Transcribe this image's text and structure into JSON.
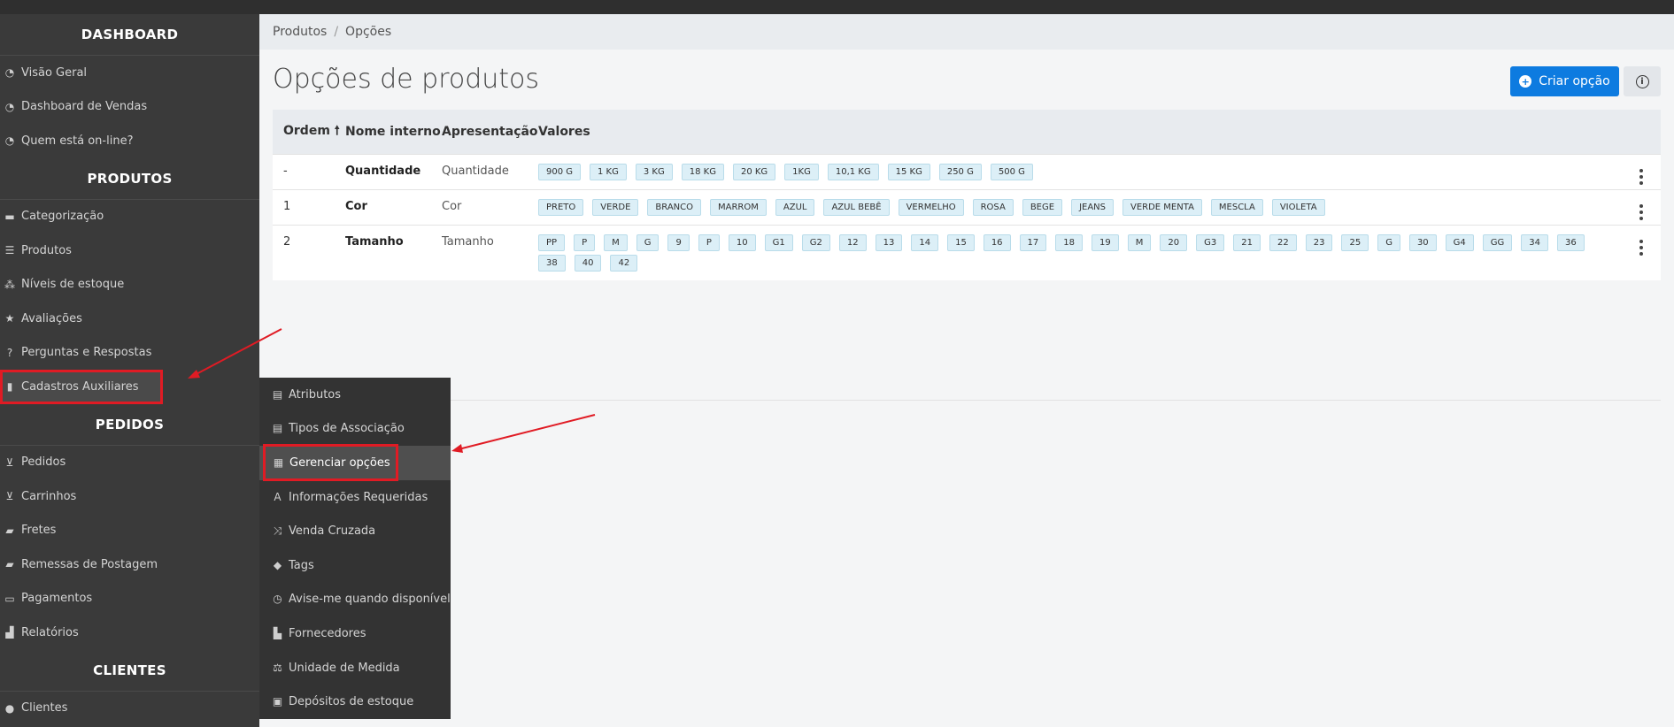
{
  "breadcrumb": [
    "Produtos",
    "Opções"
  ],
  "breadcrumb_sep": "/",
  "page_title": "Opções de produtos",
  "create_button": "Criar opção",
  "info_icon_glyph": "i",
  "sidebar": {
    "sections": [
      {
        "title": "DASHBOARD",
        "items": [
          {
            "label": "Visão Geral",
            "icon": "gauge-icon"
          },
          {
            "label": "Dashboard de Vendas",
            "icon": "gauge-icon"
          },
          {
            "label": "Quem está on-line?",
            "icon": "gauge-icon"
          }
        ]
      },
      {
        "title": "PRODUTOS",
        "items": [
          {
            "label": "Categorização",
            "icon": "folder-icon"
          },
          {
            "label": "Produtos",
            "icon": "list-icon"
          },
          {
            "label": "Níveis de estoque",
            "icon": "cubes-icon"
          },
          {
            "label": "Avaliações",
            "icon": "star-icon"
          },
          {
            "label": "Perguntas e Respostas",
            "icon": "question-icon"
          },
          {
            "label": "Cadastros Auxiliares",
            "icon": "file-icon"
          }
        ]
      },
      {
        "title": "PEDIDOS",
        "items": [
          {
            "label": "Pedidos",
            "icon": "cart-icon"
          },
          {
            "label": "Carrinhos",
            "icon": "cart-icon"
          },
          {
            "label": "Fretes",
            "icon": "truck-icon"
          },
          {
            "label": "Remessas de Postagem",
            "icon": "truck-icon"
          },
          {
            "label": "Pagamentos",
            "icon": "credit-card-icon"
          },
          {
            "label": "Relatórios",
            "icon": "bar-chart-icon"
          }
        ]
      },
      {
        "title": "CLIENTES",
        "items": [
          {
            "label": "Clientes",
            "icon": "user-icon"
          }
        ]
      }
    ]
  },
  "submenu": [
    {
      "label": "Atributos",
      "icon": "list-alt-icon"
    },
    {
      "label": "Tipos de Associação",
      "icon": "list-alt-icon"
    },
    {
      "label": "Gerenciar opções",
      "icon": "grid-icon"
    },
    {
      "label": "Informações Requeridas",
      "icon": "font-icon"
    },
    {
      "label": "Venda Cruzada",
      "icon": "random-icon"
    },
    {
      "label": "Tags",
      "icon": "tag-icon"
    },
    {
      "label": "Avise-me quando disponível",
      "icon": "clock-icon"
    },
    {
      "label": "Fornecedores",
      "icon": "industry-icon"
    },
    {
      "label": "Unidade de Medida",
      "icon": "balance-icon"
    },
    {
      "label": "Depósitos de estoque",
      "icon": "archive-icon"
    }
  ],
  "table": {
    "headers": [
      "Ordem",
      "Nome interno",
      "Apresentação",
      "Valores"
    ],
    "sort_glyph": "🠕",
    "rows": [
      {
        "order": "-",
        "name": "Quantidade",
        "presentation": "Quantidade",
        "values": [
          "900 G",
          "1 KG",
          "3 KG",
          "18 KG",
          "20 KG",
          "1KG",
          "10,1 KG",
          "15 KG",
          "250 G",
          "500 G"
        ]
      },
      {
        "order": "1",
        "name": "Cor",
        "presentation": "Cor",
        "values": [
          "PRETO",
          "VERDE",
          "BRANCO",
          "MARROM",
          "AZUL",
          "AZUL BEBÊ",
          "VERMELHO",
          "ROSA",
          "BEGE",
          "JEANS",
          "VERDE MENTA",
          "MESCLA",
          "VIOLETA"
        ]
      },
      {
        "order": "2",
        "name": "Tamanho",
        "presentation": "Tamanho",
        "values": [
          "PP",
          "P",
          "M",
          "G",
          "9",
          "P",
          "10",
          "G1",
          "G2",
          "12",
          "13",
          "14",
          "15",
          "16",
          "17",
          "18",
          "19",
          "M",
          "20",
          "G3",
          "21",
          "22",
          "23",
          "25",
          "G",
          "30",
          "G4",
          "GG",
          "34",
          "36",
          "38",
          "40",
          "42"
        ]
      }
    ]
  },
  "colors": {
    "accent": "#0d7be0",
    "highlight": "#e01b24",
    "sidebar": "#3a3a3a"
  }
}
